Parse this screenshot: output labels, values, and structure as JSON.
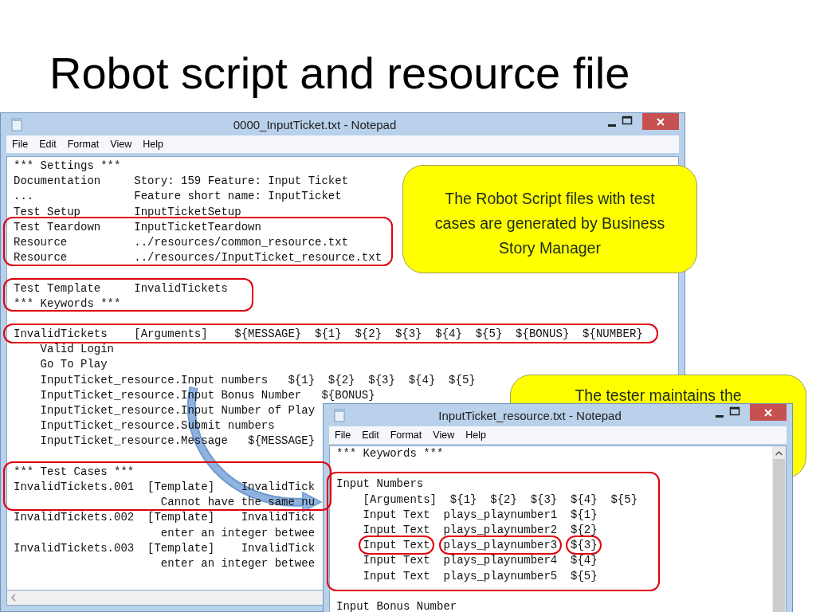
{
  "slide": {
    "title": "Robot script and resource file"
  },
  "windows": [
    {
      "title": "0000_InputTicket.txt - Notepad",
      "menu": [
        "File",
        "Edit",
        "Format",
        "View",
        "Help"
      ],
      "lines": [
        {
          "text": "*** Settings ***"
        },
        {
          "text": "Documentation     Story: 159 Feature: Input Ticket"
        },
        {
          "text": "...               Feature short name: InputTicket"
        },
        {
          "text": "Test Setup        InputTicketSetup"
        },
        {
          "text": "Test Teardown     InputTicketTeardown"
        },
        {
          "text": "Resource          ../resources/common_resource.txt"
        },
        {
          "text": "Resource          ../resources/InputTicket_resource.txt"
        },
        {
          "text": "Test Template     InvalidTickets",
          "gap_before": true
        },
        {
          "text": "*** Keywords ***"
        },
        {
          "text": "InvalidTickets    [Arguments]    ${MESSAGE}  ${1}  ${2}  ${3}  ${4}  ${5}  ${BONUS}  ${NUMBER}",
          "gap_before": true
        },
        {
          "text": "    Valid Login"
        },
        {
          "text": "    Go To Play"
        },
        {
          "text": "    InputTicket_resource.Input numbers   ${1}  ${2}  ${3}  ${4}  ${5}"
        },
        {
          "text": "    InputTicket_resource.Input Bonus Number   ${BONUS}"
        },
        {
          "text": "    InputTicket_resource.Input Number of Play"
        },
        {
          "text": "    InputTicket_resource.Submit numbers"
        },
        {
          "text": "    InputTicket_resource.Message   ${MESSAGE}"
        },
        {
          "text": "*** Test Cases ***",
          "gap_before": true
        },
        {
          "text": "InvalidTickets.001  [Template]    InvalidTick"
        },
        {
          "text": "                      Cannot have the same nu"
        },
        {
          "text": "InvalidTickets.002  [Template]    InvalidTick"
        },
        {
          "text": "                      enter an integer betwee"
        },
        {
          "text": "InvalidTickets.003  [Template]    InvalidTick"
        },
        {
          "text": "                      enter an integer betwee"
        }
      ]
    },
    {
      "title": "InputTicket_resource.txt - Notepad",
      "menu": [
        "File",
        "Edit",
        "Format",
        "View",
        "Help"
      ],
      "lines": [
        {
          "text": "*** Keywords ***"
        },
        {
          "text": "Input Numbers",
          "gap_before": true
        },
        {
          "text": "    [Arguments]  ${1}  ${2}  ${3}  ${4}  ${5}"
        },
        {
          "text": "    Input Text  plays_playnumber1  ${1}"
        },
        {
          "text": "    Input Text  plays_playnumber2  ${2}"
        },
        {
          "text": "    Input Text  plays_playnumber3  ${3}"
        },
        {
          "text": "    Input Text  plays_playnumber4  ${4}"
        },
        {
          "text": "    Input Text  plays_playnumber5  ${5}"
        },
        {
          "text": "Input Bonus Number",
          "gap_before": true
        }
      ]
    }
  ],
  "callouts": [
    {
      "text": "The Robot Script files with test cases are generated by Business Story Manager"
    },
    {
      "text": "The tester maintains the"
    }
  ]
}
